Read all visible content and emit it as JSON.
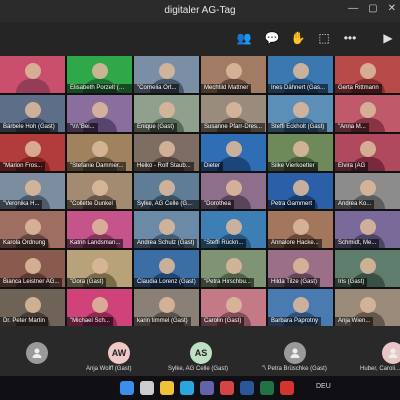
{
  "window": {
    "title": "digitaler AG-Tag",
    "controls": [
      "—",
      "▢",
      "✕"
    ]
  },
  "toolbar": {
    "icons": [
      "people-icon",
      "chat-icon",
      "reactions-icon",
      "share-icon",
      "more-icon",
      "camera-icon"
    ],
    "glyphs": [
      "👥",
      "💬",
      "✋",
      "⬚",
      "•••",
      "▶"
    ]
  },
  "participants": [
    {
      "name": "",
      "bg": "#c94f6d",
      "shirt": "#8c3a55"
    },
    {
      "name": "Elisabeth Porzelt (Gast)",
      "bg": "#2fa84a",
      "shirt": "#1c6b2e"
    },
    {
      "name": "\"Cornelia Ort...",
      "bg": "#7a8fa6",
      "shirt": "#3e4c5e"
    },
    {
      "name": "Mechtild Mattner",
      "bg": "#a27b64",
      "shirt": "#5b4132"
    },
    {
      "name": "Ines Dähnert (Gas...",
      "bg": "#3b78b0",
      "shirt": "#1f4e7a"
    },
    {
      "name": "Gerta Rittmann",
      "bg": "#b84a4a",
      "shirt": "#7a2c2c"
    },
    {
      "name": "Bärbele Hoh (Gast)",
      "bg": "#5d6f88",
      "shirt": "#34455c"
    },
    {
      "name": "\"\\\\\\\\\"Bei...",
      "bg": "#8a6f9e",
      "shirt": "#4f3d63"
    },
    {
      "name": "Enique (Gast)",
      "bg": "#8fa08c",
      "shirt": "#4f604d"
    },
    {
      "name": "Susanne Pfarr-Dres...",
      "bg": "#9a8c7c",
      "shirt": "#5a4e41"
    },
    {
      "name": "Steffi Eckholt (Gast)",
      "bg": "#5b8fb8",
      "shirt": "#2e5b80"
    },
    {
      "name": "\"Anna M...",
      "bg": "#c05a6a",
      "shirt": "#7d2f3d"
    },
    {
      "name": "\"Marion Fros...",
      "bg": "#b23b3b",
      "shirt": "#7a1f1f"
    },
    {
      "name": "\"Stefanie Dammer...",
      "bg": "#a0835e",
      "shirt": "#5e4a31"
    },
    {
      "name": "Heiko - Rolf Staub...",
      "bg": "#7d6d63",
      "shirt": "#4a3e37"
    },
    {
      "name": "Dieter",
      "bg": "#2f6db5",
      "shirt": "#173f70"
    },
    {
      "name": "Silke Vierkoetter",
      "bg": "#6e8a5a",
      "shirt": "#3f5532"
    },
    {
      "name": "Elvira (AG",
      "bg": "#b1495e",
      "shirt": "#6e2536"
    },
    {
      "name": "\"Veronika H...",
      "bg": "#7b8d9f",
      "shirt": "#44525f"
    },
    {
      "name": "\"Collette Dunkel",
      "bg": "#a38b72",
      "shirt": "#5f4e3e"
    },
    {
      "name": "Sylke, AG Celle (Gast)",
      "bg": "#5f7d97",
      "shirt": "#33495b"
    },
    {
      "name": "\"Dorothea",
      "bg": "#8d6e8b",
      "shirt": "#523d50"
    },
    {
      "name": "Petra Gammert",
      "bg": "#2b5fa8",
      "shirt": "#17386a"
    },
    {
      "name": "Andrea Ko...",
      "bg": "#8c8c8c",
      "shirt": "#555555"
    },
    {
      "name": "Karola Ordnung",
      "bg": "#9f6e63",
      "shirt": "#5e3e37"
    },
    {
      "name": "Katrin Landsman...",
      "bg": "#c4548a",
      "shirt": "#7e2f56"
    },
    {
      "name": "Andrea Schulz (Gast)",
      "bg": "#6b8aa8",
      "shirt": "#3b5570"
    },
    {
      "name": "\"Steffi Rückn...",
      "bg": "#3d7fb4",
      "shirt": "#1f4f78"
    },
    {
      "name": "Annalore Hacke...",
      "bg": "#a2775d",
      "shirt": "#613f2e"
    },
    {
      "name": "Schmidt, Me...",
      "bg": "#7a6a9a",
      "shirt": "#463c5c"
    },
    {
      "name": "Bianca Leistner AG...",
      "bg": "#8a5a4f",
      "shirt": "#54342c"
    },
    {
      "name": "\"Dora (Gast)",
      "bg": "#b7a27a",
      "shirt": "#6e603f"
    },
    {
      "name": "Claudia Lorenz (Gast)",
      "bg": "#3a6ea5",
      "shirt": "#1c4067"
    },
    {
      "name": "\"Petra Hirschbu...",
      "bg": "#7f9474",
      "shirt": "#485743"
    },
    {
      "name": "Hilda Tilze (Gast)",
      "bg": "#9b6f88",
      "shirt": "#5c3e50"
    },
    {
      "name": "Iris (Gast)",
      "bg": "#5e7d6c",
      "shirt": "#33493d"
    },
    {
      "name": "Dr. Peter Martin",
      "bg": "#6f6358",
      "shirt": "#3f3730"
    },
    {
      "name": "\"Michael Sch...",
      "bg": "#d0427a",
      "shirt": "#86244c"
    },
    {
      "name": "karin timmel (Gast)",
      "bg": "#8b8076",
      "shirt": "#524a43"
    },
    {
      "name": "Carolin (Gast)",
      "bg": "#c47a86",
      "shirt": "#7a4550"
    },
    {
      "name": "Barbara Paprotny",
      "bg": "#4a7bb0",
      "shirt": "#284c73"
    },
    {
      "name": "Anja Wien...",
      "bg": "#9a8a7a",
      "shirt": "#5b4f44"
    }
  ],
  "bottom_row": [
    {
      "initials": "",
      "name": "",
      "color": "#9a9a9a",
      "icon": "person-icon"
    },
    {
      "initials": "AW",
      "name": "Anja Wolff (Gast)",
      "color": "#f0c8c8"
    },
    {
      "initials": "AS",
      "name": "Sylke, AG Celle (Gast)",
      "color": "#bfe0c4"
    },
    {
      "initials": "",
      "name": "\"\\ Petra Brüschke (Gast)",
      "color": "#9a9a9a",
      "icon": "person-icon"
    },
    {
      "initials": "",
      "name": "Huber, Caroli...",
      "color": "#e9c6c6"
    }
  ],
  "taskbar": {
    "language": "DEU",
    "time": "",
    "icons": [
      {
        "name": "start-icon",
        "color": "#3b8eea"
      },
      {
        "name": "search-icon",
        "color": "#cccccc"
      },
      {
        "name": "files-icon",
        "color": "#f0c23a"
      },
      {
        "name": "browser-icon",
        "color": "#2aa6df"
      },
      {
        "name": "teams-icon",
        "color": "#6264a7"
      },
      {
        "name": "mail-icon",
        "color": "#d64545"
      },
      {
        "name": "word-icon",
        "color": "#2b579a"
      },
      {
        "name": "excel-icon",
        "color": "#217346"
      },
      {
        "name": "pdf-icon",
        "color": "#d4342c"
      }
    ]
  }
}
